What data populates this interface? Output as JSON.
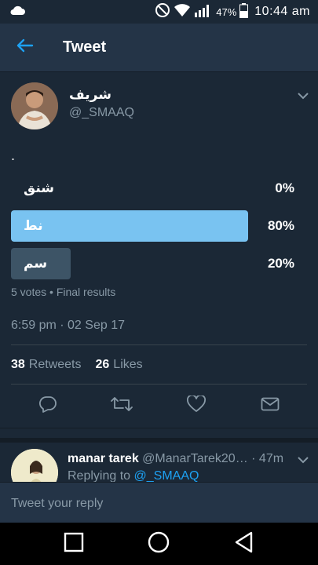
{
  "status_bar": {
    "battery_percent": "47%",
    "time": "10:44 am",
    "icons": [
      "cloud-icon",
      "do-not-disturb-icon",
      "wifi-icon",
      "signal-icon",
      "battery-icon"
    ]
  },
  "app_bar": {
    "title": "Tweet",
    "back_icon": "back-arrow-icon"
  },
  "tweet": {
    "author": {
      "name": "شريف",
      "handle": "@_SMAAQ"
    },
    "text": ".",
    "poll": {
      "options": [
        {
          "label": "شنق",
          "percent": "0%",
          "fraction": 0.0,
          "winner": false
        },
        {
          "label": "نط",
          "percent": "80%",
          "fraction": 0.8,
          "winner": true
        },
        {
          "label": "سم",
          "percent": "20%",
          "fraction": 0.2,
          "winner": false
        }
      ],
      "meta": "5 votes • Final results"
    },
    "timestamp": "6:59 pm · 02 Sep 17",
    "retweets_count": "38",
    "retweets_label": "Retweets",
    "likes_count": "26",
    "likes_label": "Likes"
  },
  "reply": {
    "name": "manar tarek",
    "handle": "@ManarTarek20…",
    "time": "· 47m",
    "replying_prefix": "Replying to",
    "replying_mention": "@_SMAAQ"
  },
  "compose": {
    "placeholder": "Tweet your reply"
  },
  "colors": {
    "background": "#1b2836",
    "header": "#243447",
    "accent": "#1da1f2",
    "poll_winner": "#79c3f1",
    "poll_other": "#3d5466",
    "secondary_text": "#8899a6"
  }
}
